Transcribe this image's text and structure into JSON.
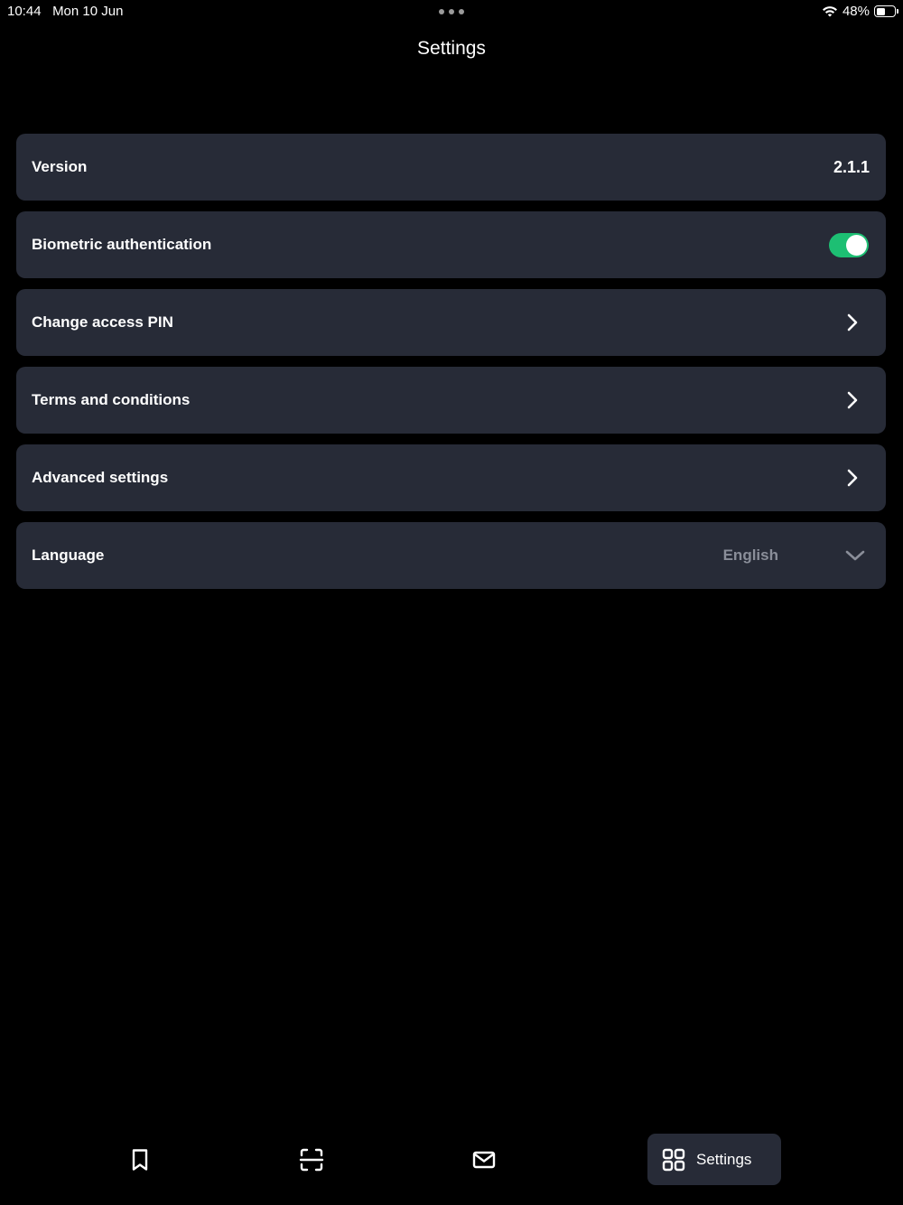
{
  "status_bar": {
    "time": "10:44",
    "date": "Mon 10 Jun",
    "battery": "48%",
    "battery_level": 0.48
  },
  "header": {
    "title": "Settings"
  },
  "settings": {
    "version": {
      "label": "Version",
      "value": "2.1.1"
    },
    "biometric": {
      "label": "Biometric authentication",
      "enabled": true
    },
    "change_pin": {
      "label": "Change access PIN"
    },
    "terms": {
      "label": "Terms and conditions"
    },
    "advanced": {
      "label": "Advanced settings"
    },
    "language": {
      "label": "Language",
      "value": "English"
    }
  },
  "tab_bar": {
    "tabs": [
      {
        "icon": "bookmark-icon"
      },
      {
        "icon": "scan-icon"
      },
      {
        "icon": "mail-icon"
      },
      {
        "icon": "grid-icon",
        "label": "Settings",
        "active": true
      }
    ]
  },
  "colors": {
    "background": "#000000",
    "card": "#272b37",
    "toggle_on": "#1dbf73",
    "muted_text": "#8a8e99"
  }
}
